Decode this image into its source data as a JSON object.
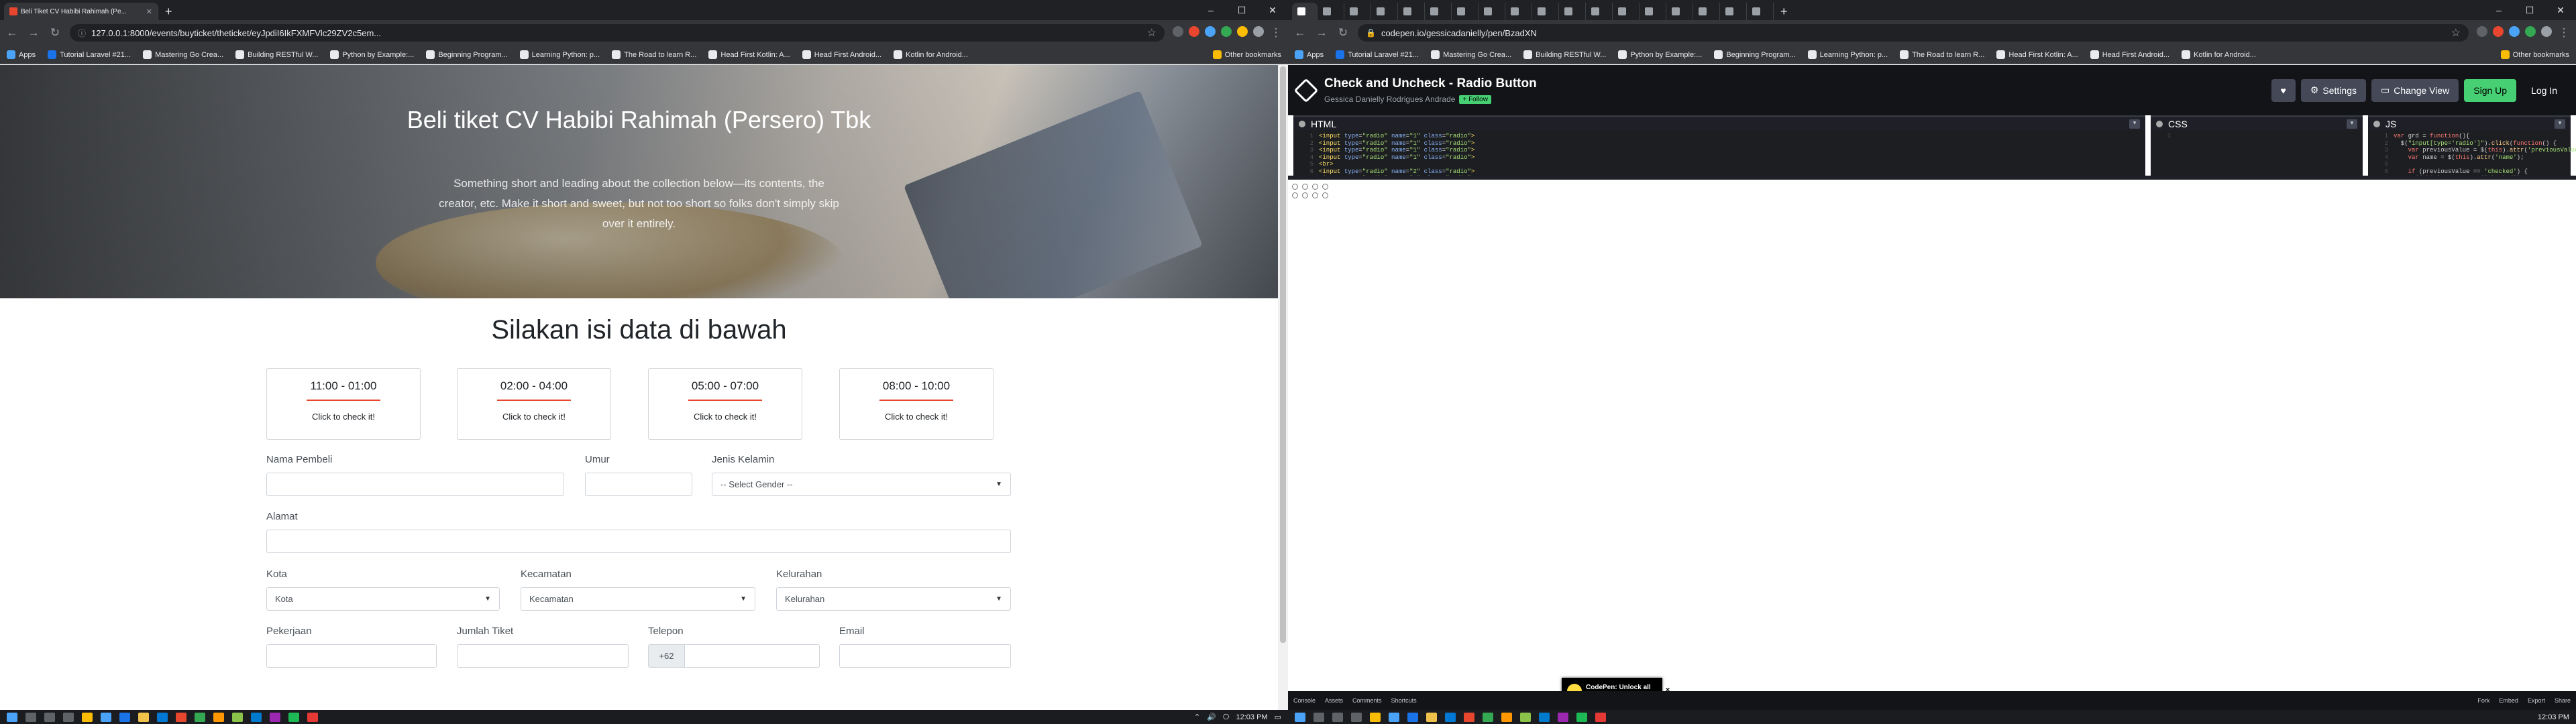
{
  "left": {
    "tabs": [
      {
        "title": "Beli Tiket CV Habibi Rahimah (Pe...",
        "active": true
      }
    ],
    "url": "127.0.0.1:8000/events/buyticket/theticket/eyJpdiI6IkFXMFVlc29ZV2c5em...",
    "bookmarks": [
      "Apps",
      "Tutorial Laravel #21...",
      "Mastering Go Crea...",
      "Building RESTful W...",
      "Python by Example:...",
      "Beginning Program...",
      "Learning Python: p...",
      "The Road to learn R...",
      "Head First Kotlin: A...",
      "Head First Android...",
      "Kotlin for Android..."
    ],
    "other_bookmarks": "Other bookmarks",
    "hero": {
      "title": "Beli tiket CV Habibi Rahimah (Persero) Tbk",
      "subtitle": "Something short and leading about the collection below—its contents, the creator, etc. Make it short and sweet, but not too short so folks don't simply skip over it entirely."
    },
    "form": {
      "title": "Silakan isi data di bawah",
      "slots": [
        {
          "time": "11:00 - 01:00",
          "cta": "Click to check it!"
        },
        {
          "time": "02:00 - 04:00",
          "cta": "Click to check it!"
        },
        {
          "time": "05:00 - 07:00",
          "cta": "Click to check it!"
        },
        {
          "time": "08:00 - 10:00",
          "cta": "Click to check it!"
        }
      ],
      "nama_label": "Nama Pembeli",
      "umur_label": "Umur",
      "gender_label": "Jenis Kelamin",
      "gender_value": "-- Select Gender --",
      "alamat_label": "Alamat",
      "kota_label": "Kota",
      "kota_value": "Kota",
      "kecamatan_label": "Kecamatan",
      "kecamatan_value": "Kecamatan",
      "kelurahan_label": "Kelurahan",
      "kelurahan_value": "Kelurahan",
      "pekerjaan_label": "Pekerjaan",
      "jumlah_label": "Jumlah Tiket",
      "telepon_label": "Telepon",
      "telepon_prefix": "+62",
      "email_label": "Email"
    },
    "taskbar_time": "12:03 PM"
  },
  "right": {
    "url": "codepen.io/gessicadanielly/pen/BzadXN",
    "bookmarks": [
      "Apps",
      "Tutorial Laravel #21...",
      "Mastering Go Crea...",
      "Building RESTful W...",
      "Python by Example:...",
      "Beginning Program...",
      "Learning Python: p...",
      "The Road to learn R...",
      "Head First Kotlin: A...",
      "Head First Android...",
      "Kotlin for Android..."
    ],
    "other_bookmarks": "Other bookmarks",
    "pen_title": "Check and Uncheck - Radio Button",
    "author": "Gessica Danielly Rodrigues Andrade",
    "follow": "+ Follow",
    "btn_settings": "Settings",
    "btn_change_view": "Change View",
    "btn_signup": "Sign Up",
    "btn_login": "Log In",
    "ed_html": "HTML",
    "ed_css": "CSS",
    "ed_js": "JS",
    "footer_left": [
      "Console",
      "Assets",
      "Comments",
      "Shortcuts"
    ],
    "footer_right": [
      "Fork",
      "Embed",
      "Export",
      "Share"
    ],
    "ad_text": "CodePen: Unlock all of CodePen",
    "taskbar_time": "12:03 PM"
  }
}
